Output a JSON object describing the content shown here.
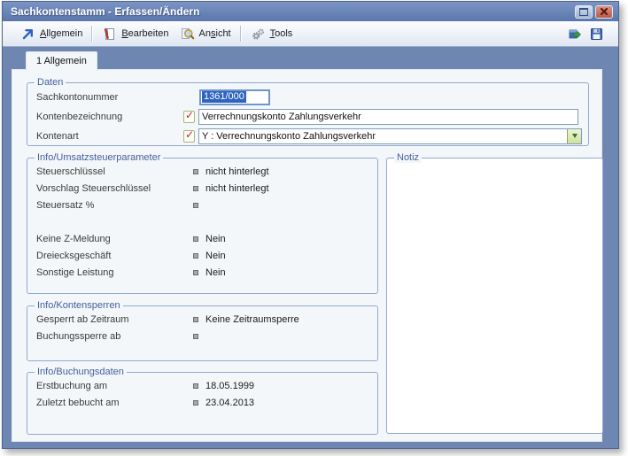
{
  "window": {
    "title": "Sachkontenstamm - Erfassen/Ändern"
  },
  "titlebar": {
    "buttons": [
      {
        "name": "restore",
        "icon": "restore-window-icon"
      },
      {
        "name": "close",
        "icon": "close-x-icon"
      }
    ]
  },
  "toolbar": {
    "items": [
      {
        "pre": "",
        "key": "A",
        "post": "llgemein",
        "icon": "arrow-northeast-icon"
      },
      {
        "pre": "",
        "key": "B",
        "post": "earbeiten",
        "icon": "notebook-pen-icon"
      },
      {
        "pre": "An",
        "key": "s",
        "post": "icht",
        "icon": "magnifier-page-icon"
      },
      {
        "pre": "",
        "key": "T",
        "post": "ools",
        "icon": "gears-icon"
      }
    ],
    "right_icons": [
      {
        "name": "export-book-arrow-icon"
      },
      {
        "name": "save-floppy-icon"
      }
    ]
  },
  "tab": {
    "label": "1 Allgemein"
  },
  "groups": {
    "daten": {
      "legend": "Daten",
      "fields": [
        {
          "label": "Sachkontonummer",
          "value": "1361/000",
          "state": "focused, text selected"
        },
        {
          "label": "Kontenbezeichnung",
          "value": "Verrechnungskonto Zahlungsverkehr",
          "checked": true
        },
        {
          "label": "Kontenart",
          "value": "Y : Verrechnungskonto Zahlungsverkehr",
          "checked": true,
          "control": "dropdown"
        }
      ]
    },
    "umsatzsteuer": {
      "legend": "Info/Umsatzsteuerparameter",
      "rows": [
        {
          "label": "Steuerschlüssel",
          "value": "nicht hinterlegt"
        },
        {
          "label": "Vorschlag Steuerschlüssel",
          "value": "nicht hinterlegt"
        },
        {
          "label": "Steuersatz %",
          "value": ""
        },
        {
          "label": "Keine Z-Meldung",
          "value": "Nein"
        },
        {
          "label": "Dreiecksgeschäft",
          "value": "Nein"
        },
        {
          "label": "Sonstige Leistung",
          "value": "Nein"
        }
      ]
    },
    "notiz": {
      "legend": "Notiz",
      "value": ""
    },
    "kontensperren": {
      "legend": "Info/Kontensperren",
      "rows": [
        {
          "label": "Gesperrt ab Zeitraum",
          "value": "Keine Zeitraumsperre"
        },
        {
          "label": "Buchungssperre ab",
          "value": ""
        }
      ]
    },
    "buchungsdaten": {
      "legend": "Info/Buchungsdaten",
      "rows": [
        {
          "label": "Erstbuchung am",
          "value": "18.05.1999"
        },
        {
          "label": "Zuletzt bebucht am",
          "value": "23.04.2013"
        }
      ]
    }
  },
  "colors": {
    "titlebar_blue": "#5e7bb0",
    "frame_blue": "#6e86b2",
    "panel_bg": "#f4f7f9",
    "group_border": "#92a8d0",
    "legend_text": "#44609e",
    "selection_blue": "#2f63c0",
    "close_button_red": "#b95a49",
    "dropdown_green": "#2f7a1e",
    "check_red": "#c8231b"
  }
}
